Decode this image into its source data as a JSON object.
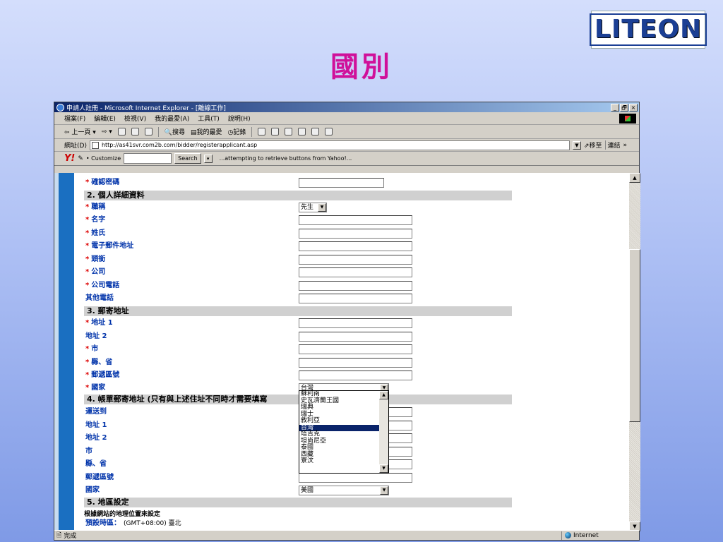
{
  "slide": {
    "title": "國別",
    "logo_text": "LITEON"
  },
  "window": {
    "title": "申請人註冊 - Microsoft Internet Explorer - [離線工作]",
    "controls": [
      "_",
      "🗗",
      "×"
    ]
  },
  "menu": [
    "檔案(F)",
    "編輯(E)",
    "檢視(V)",
    "我的最愛(A)",
    "工具(T)",
    "說明(H)"
  ],
  "toolbar": {
    "back": "上一頁",
    "search": "搜尋",
    "favorites": "我的最愛",
    "history": "記錄"
  },
  "address": {
    "label": "網址(D)",
    "url": "http://as41svr.com2b.com/bidder/registerapplicant.asp",
    "go": "移至",
    "links": "連結"
  },
  "yahoo": {
    "logo": "Y!",
    "customize": "• Customize",
    "search_btn": "Search",
    "status": "...attempting to retrieve buttons from Yahoo!..."
  },
  "form": {
    "confirm_password": "確認密碼",
    "section2": "2. 個人詳細資料",
    "title_label": "職稱",
    "title_value": "先生",
    "first_name": "名字",
    "last_name": "姓氏",
    "email": "電子郵件地址",
    "job_title": "頭銜",
    "company": "公司",
    "company_phone": "公司電話",
    "other_phone": "其他電話",
    "section3": "3. 郵寄地址",
    "address1": "地址 1",
    "address2": "地址 2",
    "city": "市",
    "county": "縣、省",
    "postcode": "郵遞區號",
    "country": "國家",
    "country_value": "台灣",
    "section4": "4. 帳單郵寄地址 (只有與上述住址不同時才需要填寫",
    "ship_to": "運送到",
    "b_address1": "地址 1",
    "b_address2": "地址 2",
    "b_city": "市",
    "b_county": "縣、省",
    "b_postcode": "郵遞區號",
    "b_country": "國家",
    "b_country_value": "美國",
    "section5": "5. 地區設定",
    "region_note": "根據網站的地理位置來設定",
    "timezone_label": "預設時區：",
    "timezone_value": "(GMT+08:00) 臺北"
  },
  "country_options": [
    "蘇利南",
    "史瓦濟蘭王國",
    "瑞典",
    "瑞士",
    "敘利亞",
    "台灣",
    "塔吉克",
    "坦尚尼亞",
    "泰國",
    "西藏",
    "寮汶"
  ],
  "country_selected_index": 5,
  "status": {
    "left": "完成",
    "zone": "Internet"
  }
}
